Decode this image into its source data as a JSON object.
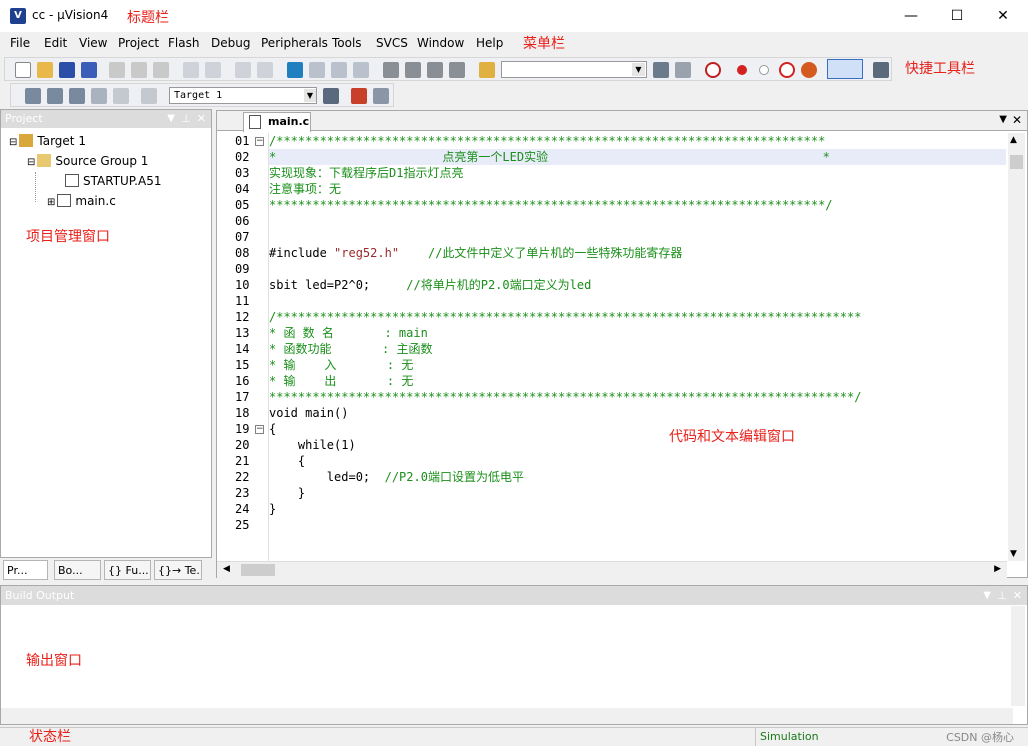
{
  "window": {
    "title": "cc  - μVision4",
    "app_icon": "keil-icon",
    "minimize": "—",
    "maximize": "☐",
    "close": "✕"
  },
  "menus": [
    "File",
    "Edit",
    "View",
    "Project",
    "Flash",
    "Debug",
    "Peripherals",
    "Tools",
    "SVCS",
    "Window",
    "Help"
  ],
  "toolbar": {
    "target_select": "Target 1"
  },
  "project_pane": {
    "title": "Project",
    "tree": {
      "target": "Target 1",
      "group": "Source Group 1",
      "file1": "STARTUP.A51",
      "file2": "main.c"
    },
    "tabs": [
      "Pr...",
      "Bo...",
      "{} Fu...",
      "{}→ Te..."
    ]
  },
  "editor": {
    "tab": "main.c",
    "line_numbers": [
      "01",
      "02",
      "03",
      "04",
      "05",
      "06",
      "07",
      "08",
      "09",
      "10",
      "11",
      "12",
      "13",
      "14",
      "15",
      "16",
      "17",
      "18",
      "19",
      "20",
      "21",
      "22",
      "23",
      "24",
      "25"
    ],
    "lines": [
      {
        "t": "/****************************************************************************",
        "c": "cmt"
      },
      {
        "t": "*                       点亮第一个LED实验                                      *",
        "c": "cmt"
      },
      {
        "t": "实现现象：下载程序后D1指示灯点亮",
        "c": "cmt"
      },
      {
        "t": "注意事项：无",
        "c": "cmt"
      },
      {
        "t": "*****************************************************************************/",
        "c": "cmt"
      },
      {
        "t": "",
        "c": ""
      },
      {
        "t": "",
        "c": ""
      },
      {
        "t": "#include \"reg52.h\"    //此文件中定义了单片机的一些特殊功能寄存器",
        "c": "mix1"
      },
      {
        "t": "",
        "c": ""
      },
      {
        "t": "sbit led=P2^0;     //将单片机的P2.0端口定义为led",
        "c": "mix2"
      },
      {
        "t": "",
        "c": ""
      },
      {
        "t": "/*********************************************************************************",
        "c": "cmt"
      },
      {
        "t": "* 函 数 名       : main",
        "c": "cmt"
      },
      {
        "t": "* 函数功能       : 主函数",
        "c": "cmt"
      },
      {
        "t": "* 输    入       : 无",
        "c": "cmt"
      },
      {
        "t": "* 输    出       : 无",
        "c": "cmt"
      },
      {
        "t": "*********************************************************************************/",
        "c": "cmt"
      },
      {
        "t": "void main()",
        "c": ""
      },
      {
        "t": "{",
        "c": ""
      },
      {
        "t": "    while(1)",
        "c": ""
      },
      {
        "t": "    {",
        "c": ""
      },
      {
        "t": "        led=0;  //P2.0端口设置为低电平",
        "c": "mix3"
      },
      {
        "t": "    }",
        "c": ""
      },
      {
        "t": "}",
        "c": ""
      },
      {
        "t": "",
        "c": ""
      }
    ]
  },
  "build_output": {
    "title": "Build Output"
  },
  "status": {
    "mode": "Simulation",
    "watermark": "CSDN @杨心"
  },
  "annotations": {
    "titlebar": "标题栏",
    "menubar": "菜单栏",
    "toolbar": "快捷工具栏",
    "project": "项目管理窗口",
    "editor": "代码和文本编辑窗口",
    "output": "输出窗口",
    "statusbar": "状态栏"
  },
  "colors": {
    "comment": "#1a8f1a",
    "string": "#9b2a2a",
    "annotation": "#e8201a",
    "highlight_line": "#e8ecf8"
  }
}
